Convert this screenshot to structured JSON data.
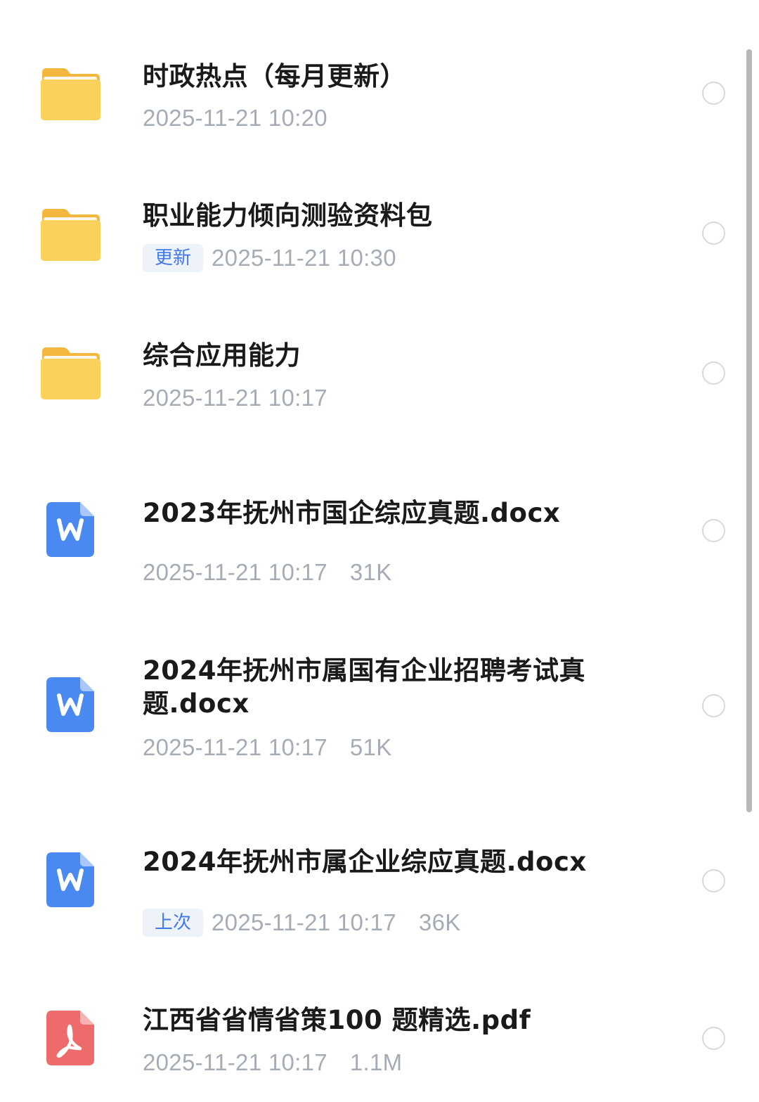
{
  "files": [
    {
      "kind": "folder",
      "icon": "folder-icon",
      "name": "时政热点（每月更新）",
      "date": "2025-11-21 10:20",
      "tag": "",
      "size": ""
    },
    {
      "kind": "folder",
      "icon": "folder-icon",
      "name": "职业能力倾向测验资料包",
      "date": "2025-11-21 10:30",
      "tag": "更新",
      "size": ""
    },
    {
      "kind": "folder",
      "icon": "folder-icon",
      "name": "综合应用能力",
      "date": "2025-11-21 10:17",
      "tag": "",
      "size": ""
    },
    {
      "kind": "docx",
      "icon": "word-document-icon",
      "name": "2023年抚州市国企综应真题.docx",
      "date": "2025-11-21 10:17",
      "tag": "",
      "size": "31K"
    },
    {
      "kind": "docx",
      "icon": "word-document-icon",
      "name": "2024年抚州市属国有企业招聘考试真题.docx",
      "date": "2025-11-21 10:17",
      "tag": "",
      "size": "51K"
    },
    {
      "kind": "docx",
      "icon": "word-document-icon",
      "name": "2024年抚州市属企业综应真题.docx",
      "date": "2025-11-21 10:17",
      "tag": "上次",
      "size": "36K"
    },
    {
      "kind": "pdf",
      "icon": "pdf-document-icon",
      "name": "江西省省情省策100 题精选.pdf",
      "date": "2025-11-21 10:17",
      "tag": "",
      "size": "1.1M"
    }
  ],
  "colors": {
    "folder": "#F9D15B",
    "word": "#4A8AF0",
    "pdf": "#EE6B6B",
    "tag_text": "#3F7AE8",
    "tag_bg": "#EEF2F9",
    "meta_text": "#A6ACB5"
  }
}
